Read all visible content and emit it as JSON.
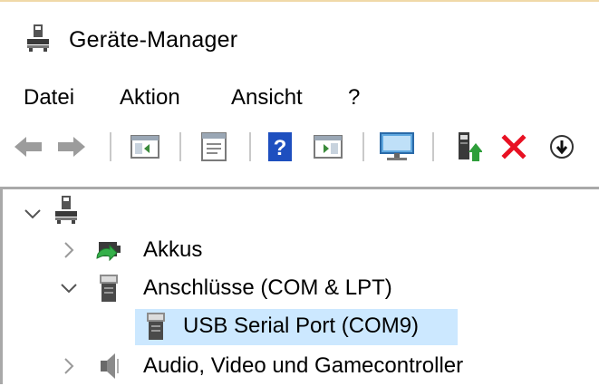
{
  "window": {
    "title": "Geräte-Manager"
  },
  "menu": {
    "items": [
      "Datei",
      "Aktion",
      "Ansicht",
      "?"
    ]
  },
  "toolbar": {
    "buttons": [
      "back-icon",
      "forward-icon",
      "show-hide-tree-icon",
      "properties-icon",
      "help-icon",
      "action-pane-icon",
      "scan-hardware-icon",
      "update-driver-icon",
      "uninstall-icon",
      "disable-device-icon"
    ]
  },
  "tree": {
    "root": {
      "icon": "computer-icon",
      "expanded": true
    },
    "nodes": [
      {
        "label": "Akkus",
        "icon": "battery-icon",
        "expanded": false
      },
      {
        "label": "Anschlüsse (COM & LPT)",
        "icon": "port-icon",
        "expanded": true
      },
      {
        "label": "USB Serial Port (COM9)",
        "icon": "port-icon",
        "selected": true
      },
      {
        "label": "Audio, Video und Gamecontroller",
        "icon": "speaker-icon",
        "expanded": false
      }
    ]
  },
  "colors": {
    "selection": "#cce8ff",
    "uninstall": "#e81123",
    "help": "#1e4fbf"
  }
}
